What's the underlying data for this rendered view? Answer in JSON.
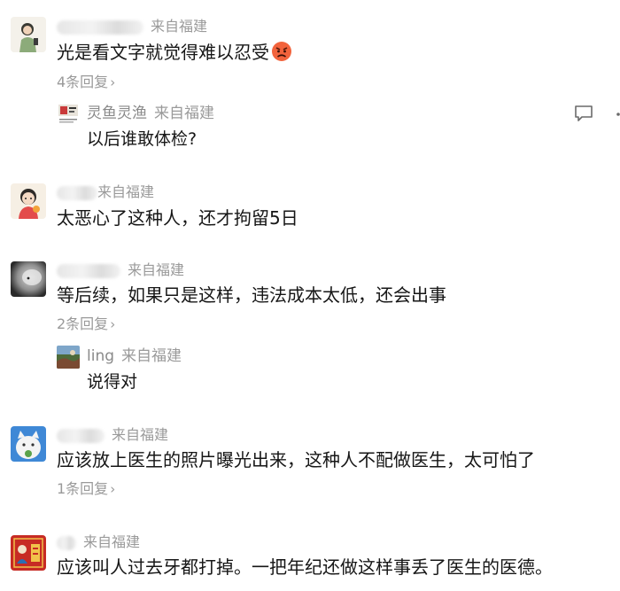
{
  "comments": [
    {
      "region": "来自福建",
      "text": "光是看文字就觉得难以忍受",
      "emoji": "angry-face-emoji",
      "replies_link": "4条回复",
      "reply": {
        "name": "灵鱼灵渔",
        "region": "来自福建",
        "text": "以后谁敢体检?"
      }
    },
    {
      "region": "来自福建",
      "text": "太恶心了这种人，还才拘留5日"
    },
    {
      "region": "来自福建",
      "text": "等后续，如果只是这样，违法成本太低，还会出事",
      "replies_link": "2条回复",
      "reply": {
        "name": "ling",
        "region": "来自福建",
        "text": "说得对"
      }
    },
    {
      "region": "来自福建",
      "text": "应该放上医生的照片曝光出来，这种人不配做医生，太可怕了",
      "replies_link": "1条回复"
    },
    {
      "region": "来自福建",
      "text": "应该叫人过去牙都打掉。一把年纪还做这样事丢了医生的医德。"
    }
  ],
  "icons": {
    "chevron": "›"
  }
}
